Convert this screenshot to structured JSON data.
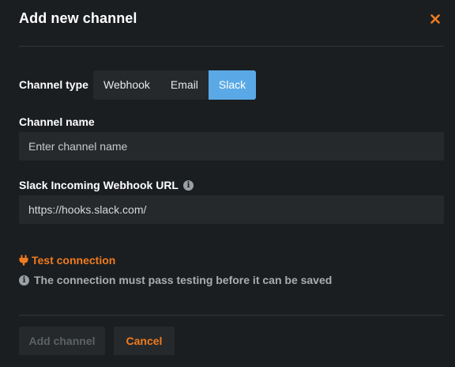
{
  "dialog": {
    "title": "Add new channel",
    "close_icon": "close-icon"
  },
  "channel_type": {
    "label": "Channel type",
    "options": [
      "Webhook",
      "Email",
      "Slack"
    ],
    "selected": "Slack"
  },
  "channel_name": {
    "label": "Channel name",
    "value": "",
    "placeholder": "Enter channel name"
  },
  "webhook_url": {
    "label": "Slack Incoming Webhook URL",
    "value": "https://hooks.slack.com/",
    "info_icon": "info-icon"
  },
  "test": {
    "link_label": "Test connection",
    "icon": "plug-icon",
    "note": "The connection must pass testing before it can be saved",
    "note_icon": "info-icon"
  },
  "footer": {
    "add_label": "Add channel",
    "add_disabled": true,
    "cancel_label": "Cancel"
  },
  "colors": {
    "background": "#1b1e21",
    "surface": "#26292c",
    "accent": "#f07b1e",
    "selected": "#5aa9e6"
  }
}
